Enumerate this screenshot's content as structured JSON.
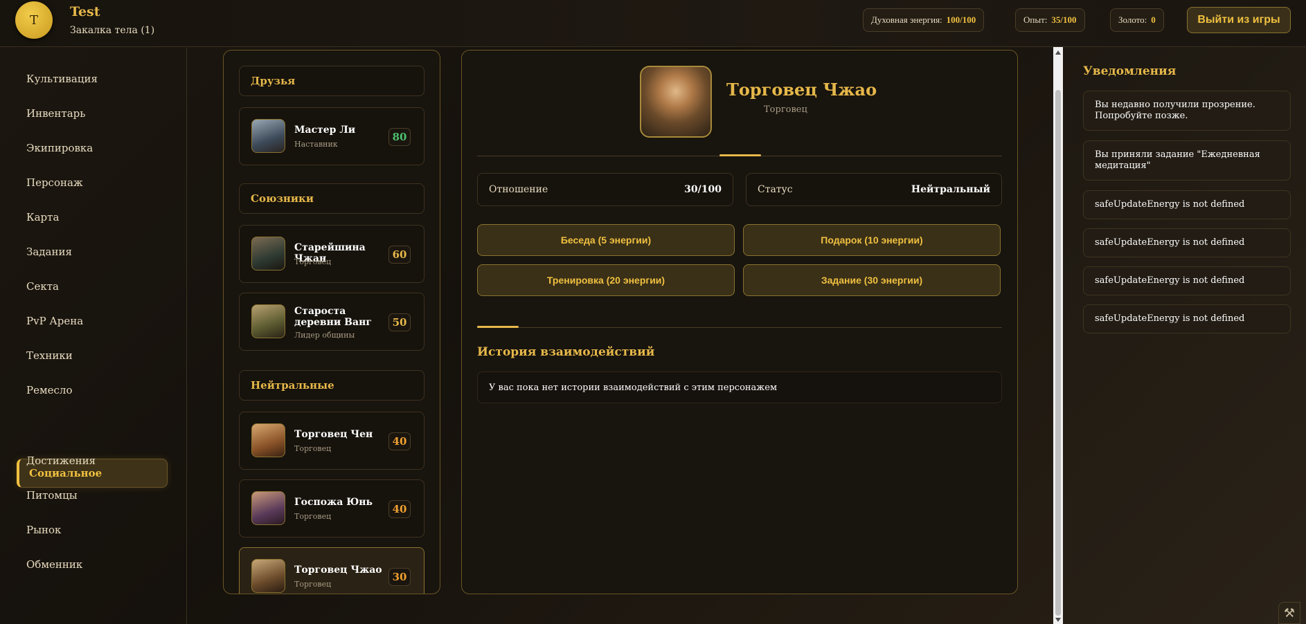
{
  "header": {
    "avatar_letter": "T",
    "username": "Test",
    "rank": "Закалка тела (1)",
    "stats": [
      {
        "label": "Духовная энергия:",
        "value": "100/100"
      },
      {
        "label": "Опыт:",
        "value": "35/100"
      },
      {
        "label": "Золото:",
        "value": "0"
      }
    ],
    "logout_label": "Выйти из игры"
  },
  "sidebar": {
    "items": [
      "Культивация",
      "Инвентарь",
      "Экипировка",
      "Персонаж",
      "Карта",
      "Задания",
      "Секта",
      "PvP Арена",
      "Техники",
      "Ремесло",
      "Социальное",
      "Достижения",
      "Питомцы",
      "Рынок",
      "Обменник"
    ],
    "active_index": 10
  },
  "contacts": {
    "groups": [
      "Друзья",
      "Союзники",
      "Нейтральные"
    ],
    "cards": [
      {
        "name": "Мастер Ли",
        "role": "Наставник",
        "score": "80",
        "score_color": "#4cc070"
      },
      {
        "name": "Старейшина Чжан",
        "role": "Торговец",
        "score": "60",
        "score_color": "#e6b84a"
      },
      {
        "name": "Староста деревни Ванг",
        "role": "Лидер общины",
        "score": "50",
        "score_color": "#e6b84a"
      },
      {
        "name": "Торговец Чен",
        "role": "Торговец",
        "score": "40",
        "score_color": "#f0a030"
      },
      {
        "name": "Госпожа Юнь",
        "role": "Торговец",
        "score": "40",
        "score_color": "#f0a030"
      },
      {
        "name": "Торговец Чжао",
        "role": "Торговец",
        "score": "30",
        "score_color": "#f0a030"
      }
    ]
  },
  "detail": {
    "name": "Торговец Чжао",
    "role": "Торговец",
    "relation_label": "Отношение",
    "relation_value": "30/100",
    "status_label": "Статус",
    "status_value": "Нейтральный",
    "actions": [
      "Беседа (5 энергии)",
      "Подарок (10 энергии)",
      "Тренировка (20 энергии)",
      "Задание (30 энергии)"
    ],
    "history_title": "История взаимодействий",
    "history_empty": "У вас пока нет истории взаимодействий с этим персонажем"
  },
  "notifications": {
    "title": "Уведомления",
    "items": [
      "Вы недавно получили прозрение. Попробуйте позже.",
      "Вы приняли задание \"Ежедневная медитация\"",
      "safeUpdateEnergy is not defined",
      "safeUpdateEnergy is not defined",
      "safeUpdateEnergy is not defined",
      "safeUpdateEnergy is not defined"
    ]
  },
  "colors": {
    "accent": "#e6b84a",
    "gold": "#f0c040",
    "panel_border": "#6a5626"
  },
  "icons": {
    "tools": "tools-icon"
  }
}
